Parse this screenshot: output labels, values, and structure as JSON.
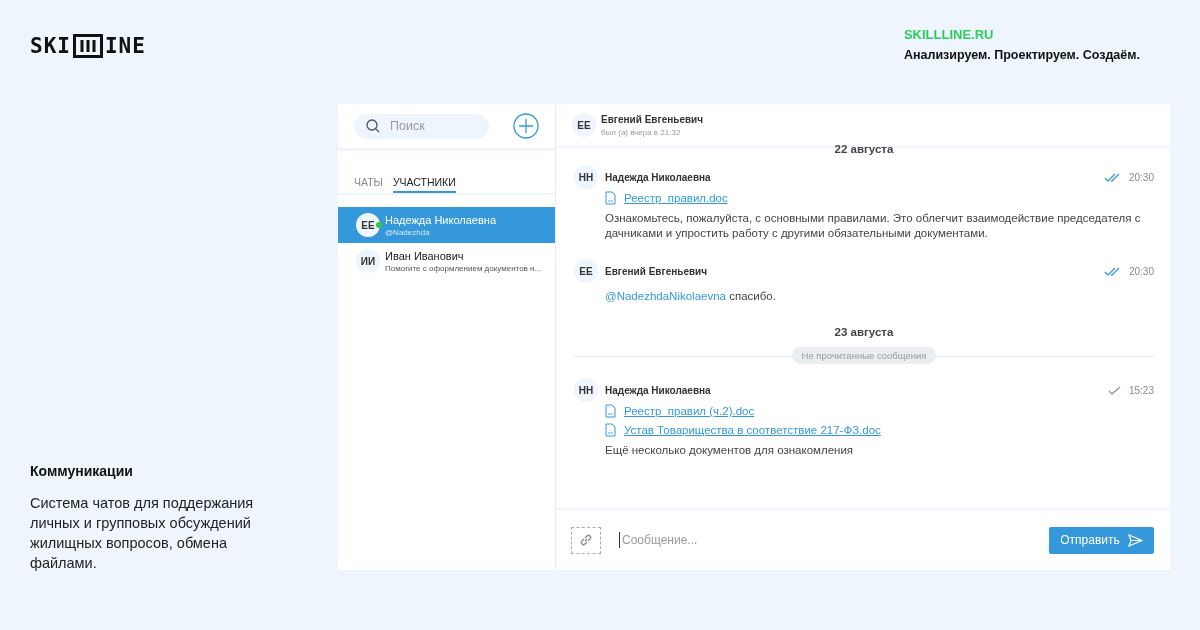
{
  "brand": {
    "logo_left": "SKI",
    "logo_right": "INE",
    "site": "SKILLLINE.RU",
    "slogan": "Анализируем. Проектируем. Создаём."
  },
  "feature": {
    "title": "Коммуникации",
    "description": "Система чатов для поддержания личных и групповых обсуждений жилищных вопросов, обмена файлами."
  },
  "sidebar": {
    "search": {
      "placeholder": "Поиск"
    },
    "tabs": [
      {
        "label": "ЧАТЫ",
        "selected": false
      },
      {
        "label": "УЧАСТНИКИ",
        "selected": true
      }
    ],
    "contacts": [
      {
        "initials": "ЕЕ",
        "name": "Надежда Николаевна",
        "subtitle": "@Nadezhda",
        "selected": true,
        "online": true
      },
      {
        "initials": "ИИ",
        "name": "Иван Иванович",
        "subtitle": "Помогите с оформлением документов н...",
        "selected": false,
        "online": false
      }
    ]
  },
  "chat": {
    "header": {
      "initials": "ЕЕ",
      "name": "Евгений Евгеньевич",
      "status": "был (а) вчера в 21:32"
    },
    "feed": [
      {
        "kind": "date",
        "text": "22 августа"
      },
      {
        "kind": "message",
        "initials": "НН",
        "author": "Надежда Николаевна",
        "time": "20:30",
        "read": true,
        "files": [
          "Реестр_правил.doc"
        ],
        "text": "Ознакомьтесь, пожалуйста, с основными правилами. Это облегчит взаимодействие председателя с дачниками и упростить работу с другими обязательными документами."
      },
      {
        "kind": "message",
        "initials": "ЕЕ",
        "author": "Евгений Евгеньевич",
        "time": "20:30",
        "read": true,
        "mention": "@NadezhdaNikolaevna",
        "text": "спасибо."
      },
      {
        "kind": "date",
        "text": "23 августа"
      },
      {
        "kind": "divider",
        "text": "Не прочитанные сообщения"
      },
      {
        "kind": "message",
        "initials": "НН",
        "author": "Надежда Николаевна",
        "time": "15:23",
        "read": false,
        "files": [
          "Реестр_правил (ч.2).doc",
          "Устав Товарищества в соответствие 217-ФЗ.doc"
        ],
        "text": "Ещё несколько документов для ознакомления"
      }
    ],
    "composer": {
      "placeholder": "Сообщение...",
      "send": "Отправить"
    }
  }
}
